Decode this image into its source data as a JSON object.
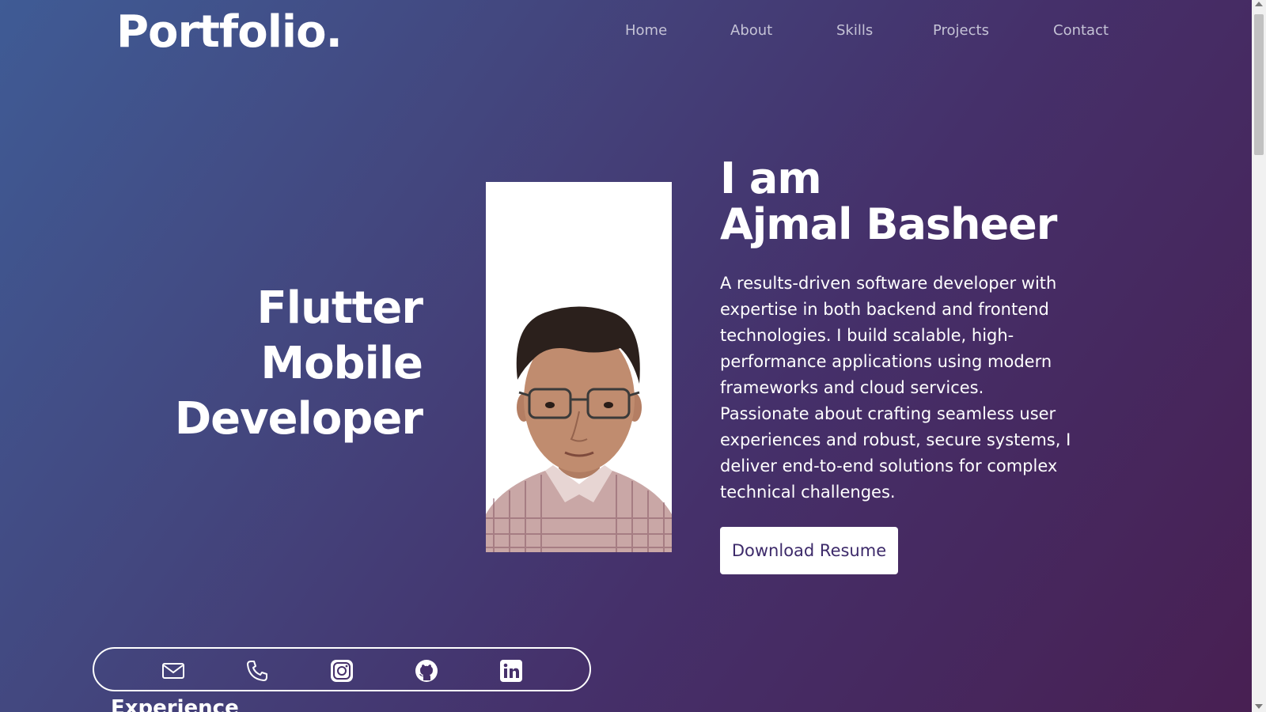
{
  "header": {
    "logo": "Portfolio.",
    "nav": {
      "home": "Home",
      "about": "About",
      "skills": "Skills",
      "projects": "Projects",
      "contact": "Contact"
    }
  },
  "hero": {
    "role_lines": [
      "Flutter",
      "Mobile",
      "Developer"
    ],
    "greeting": "I am",
    "name": "Ajmal Basheer",
    "bio": "A results-driven software developer with expertise in both backend and frontend technologies. I build scalable, high-performance applications using modern frameworks and cloud services. Passionate about crafting seamless user experiences and robust, secure systems, I deliver end-to-end solutions for complex technical challenges.",
    "resume_button": "Download Resume"
  },
  "social": {
    "icons": [
      "mail-icon",
      "phone-icon",
      "instagram-icon",
      "github-icon",
      "linkedin-icon"
    ]
  },
  "sections": {
    "experience": "Experience"
  },
  "colors": {
    "gradient_start": "#3f5b95",
    "gradient_end": "#481f52",
    "button_text": "#3d2a6a",
    "nav_text": "#c5c3d6"
  }
}
